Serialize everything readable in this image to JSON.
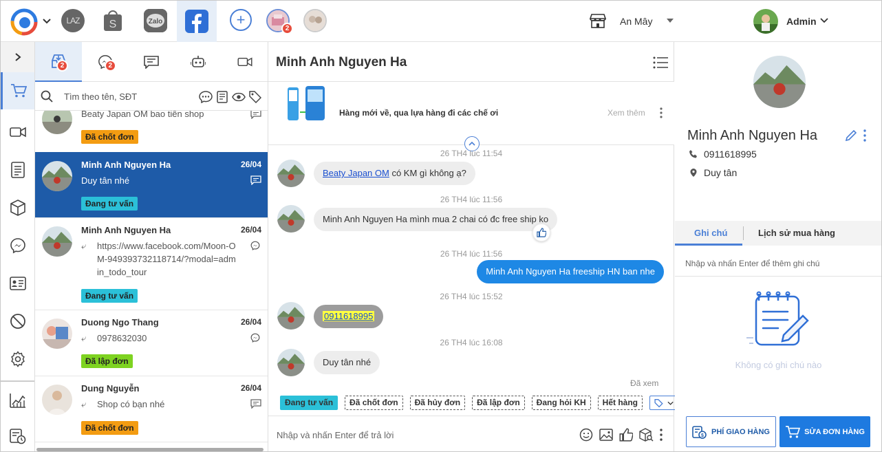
{
  "topbar": {
    "channel_laz": "LAZ",
    "avatar_badge": "2",
    "store_name": "An Mây",
    "admin_name": "Admin"
  },
  "sidebar": {
    "items": [
      "cart",
      "video",
      "orders",
      "products",
      "messenger",
      "contacts",
      "blocked",
      "settings",
      "reports",
      "history"
    ]
  },
  "list_tabs": [
    {
      "icon": "inbox-icon",
      "badge": "2"
    },
    {
      "icon": "messenger-icon",
      "badge": "2"
    },
    {
      "icon": "comment-icon",
      "badge": ""
    },
    {
      "icon": "bot-icon",
      "badge": ""
    },
    {
      "icon": "video-icon",
      "badge": ""
    }
  ],
  "search": {
    "placeholder": "Tìm theo tên, SĐT"
  },
  "conversations": [
    {
      "name": "",
      "date": "",
      "message": "Beaty Japan OM bao tiền shop",
      "tag": "Đã chốt đơn"
    },
    {
      "name": "Minh Anh Nguyen Ha",
      "date": "26/04",
      "message": "Duy tân nhé",
      "tag": "Đang tư vấn"
    },
    {
      "name": "Minh Anh Nguyen Ha",
      "date": "26/04",
      "message": "https://www.facebook.com/Moon-OM-949393732118714/?modal=admin_todo_tour",
      "tag": "Đang tư vấn"
    },
    {
      "name": "Duong Ngo Thang",
      "date": "26/04",
      "message": "0978632030",
      "tag": "Đã lập đơn"
    },
    {
      "name": "Dung Nguyễn",
      "date": "26/04",
      "message": "Shop có bạn nhé",
      "tag": "Đã chốt đơn"
    }
  ],
  "chat": {
    "title": "Minh Anh Nguyen Ha",
    "promo_text": "Hàng mới về, qua lựa hàng đi các chế ơi",
    "promo_more": "Xem thêm",
    "messages": [
      {
        "time": "26 TH4 lúc 11:54",
        "link": "Beaty Japan OM",
        "text": " có KM gì không ạ?"
      },
      {
        "time": "26 TH4 lúc 11:56",
        "text": "Minh Anh Nguyen Ha mình mua 2 chai có đc free ship ko"
      },
      {
        "time": "26 TH4 lúc 11:56",
        "text": "Minh Anh Nguyen Ha freeship HN ban nhe"
      },
      {
        "time": "26 TH4 lúc 15:52",
        "text": "0911618995"
      },
      {
        "time": "26 TH4 lúc 16:08",
        "text": "Duy tân nhé"
      }
    ],
    "seen": "Đã xem",
    "quick_tags": [
      "Đang tư vấn",
      "Đã chốt đơn",
      "Đã hủy đơn",
      "Đã lập đơn",
      "Đang hỏi KH",
      "Hết hàng"
    ],
    "compose_placeholder": "Nhập và nhấn Enter để trả lời"
  },
  "profile": {
    "name": "Minh Anh Nguyen Ha",
    "phone": "0911618995",
    "address": "Duy tân",
    "tab_notes": "Ghi chú",
    "tab_history": "Lịch sử mua hàng",
    "note_placeholder": "Nhập và nhấn Enter để thêm ghi chú",
    "empty_notes": "Không có ghi chú nào",
    "btn_shipping": "PHÍ GIAO HÀNG",
    "btn_edit_order": "SỬA ĐƠN HÀNG"
  },
  "colors": {
    "accent": "#4a7fd6",
    "active_row": "#1e5ba8",
    "outgoing": "#1e88e5"
  }
}
